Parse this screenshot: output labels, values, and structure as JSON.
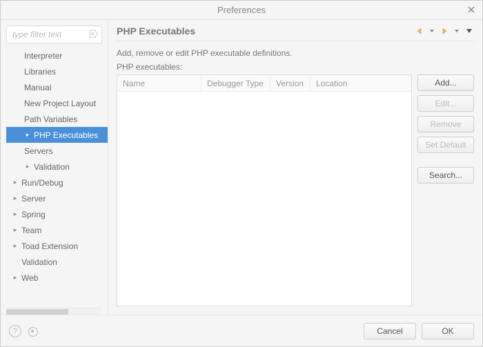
{
  "window": {
    "title": "Preferences"
  },
  "sidebar": {
    "filter_placeholder": "type filter text",
    "items": [
      {
        "label": "Interpreter",
        "indent": 1,
        "arrow": false,
        "selected": false
      },
      {
        "label": "Libraries",
        "indent": 1,
        "arrow": false,
        "selected": false
      },
      {
        "label": "Manual",
        "indent": 1,
        "arrow": false,
        "selected": false
      },
      {
        "label": "New Project Layout",
        "indent": 1,
        "arrow": false,
        "selected": false
      },
      {
        "label": "Path Variables",
        "indent": 1,
        "arrow": false,
        "selected": false
      },
      {
        "label": "PHP Executables",
        "indent": 1,
        "arrow": true,
        "selected": true
      },
      {
        "label": "Servers",
        "indent": 1,
        "arrow": false,
        "selected": false
      },
      {
        "label": "Validation",
        "indent": 1,
        "arrow": true,
        "selected": false
      },
      {
        "label": "Run/Debug",
        "indent": 0,
        "arrow": true,
        "selected": false
      },
      {
        "label": "Server",
        "indent": 0,
        "arrow": true,
        "selected": false
      },
      {
        "label": "Spring",
        "indent": 0,
        "arrow": true,
        "selected": false
      },
      {
        "label": "Team",
        "indent": 0,
        "arrow": true,
        "selected": false
      },
      {
        "label": "Toad Extension",
        "indent": 0,
        "arrow": true,
        "selected": false
      },
      {
        "label": "Validation",
        "indent": 0,
        "arrow": false,
        "selected": false
      },
      {
        "label": "Web",
        "indent": 0,
        "arrow": true,
        "selected": false
      }
    ]
  },
  "main": {
    "title": "PHP Executables",
    "description": "Add, remove or edit PHP executable definitions.",
    "list_label": "PHP executables:",
    "columns": [
      "Name",
      "Debugger Type",
      "Version",
      "Location"
    ]
  },
  "buttons": {
    "add": "Add...",
    "edit": "Edit...",
    "remove": "Remove",
    "set_default": "Set Default",
    "search": "Search..."
  },
  "footer": {
    "cancel": "Cancel",
    "ok": "OK"
  }
}
